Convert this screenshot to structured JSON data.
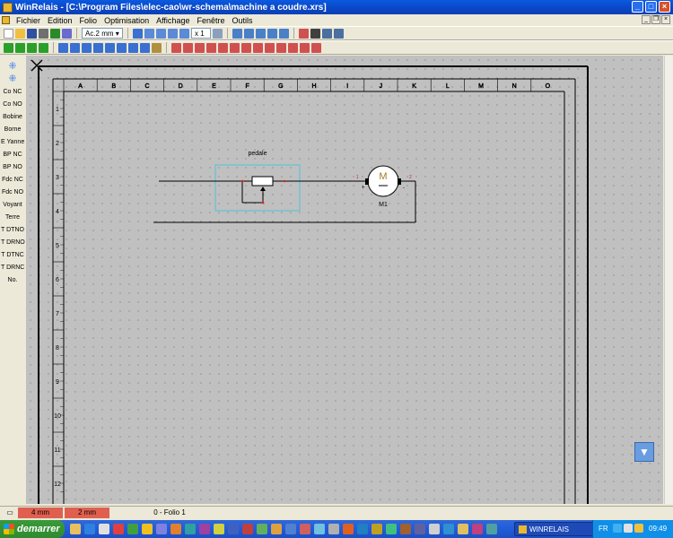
{
  "window": {
    "title": "WinRelais - [C:\\Program Files\\elec-cao\\wr-schema\\machine a coudre.xrs]"
  },
  "menu": {
    "items": [
      "Fichier",
      "Edition",
      "Folio",
      "Optimisation",
      "Affichage",
      "Fenêtre",
      "Outils"
    ]
  },
  "toolbar": {
    "grid_combo": "Ac.2 mm",
    "zoom_combo": "x 1"
  },
  "sidebar": {
    "items": [
      "Co NC",
      "Co NO",
      "Bobine",
      "Borne",
      "E Yanne",
      "BP NC",
      "BP NO",
      "Fdc NC",
      "Fdc NO",
      "Voyant",
      "Terre",
      "T DTNO",
      "T DRNO",
      "T DTNC",
      "T DRNC",
      "No."
    ]
  },
  "sheet": {
    "columns": [
      "A",
      "B",
      "C",
      "D",
      "E",
      "F",
      "G",
      "H",
      "I",
      "J",
      "K",
      "L",
      "M",
      "N",
      "O"
    ],
    "rows": [
      "1",
      "2",
      "3",
      "4",
      "5",
      "6",
      "7",
      "8",
      "9",
      "10",
      "11",
      "12"
    ]
  },
  "schematic": {
    "component_label": "pedale",
    "motor_symbol": "M",
    "motor_name": "M1",
    "pin1": "1",
    "pin2": "2",
    "plus": "+",
    "minus": "-"
  },
  "statusbar": {
    "x_coord": "4 mm",
    "y_coord": "2 mm",
    "folio": "0 - Folio 1"
  },
  "taskbar": {
    "start_label": "demarrer",
    "task_label": "WINRELAIS",
    "lang": "FR",
    "clock": "09:49"
  },
  "colors": {
    "accent": "#0a5ae0",
    "wire": "#000000",
    "select_box": "#4fc3d8",
    "status_red": "#e06050"
  }
}
